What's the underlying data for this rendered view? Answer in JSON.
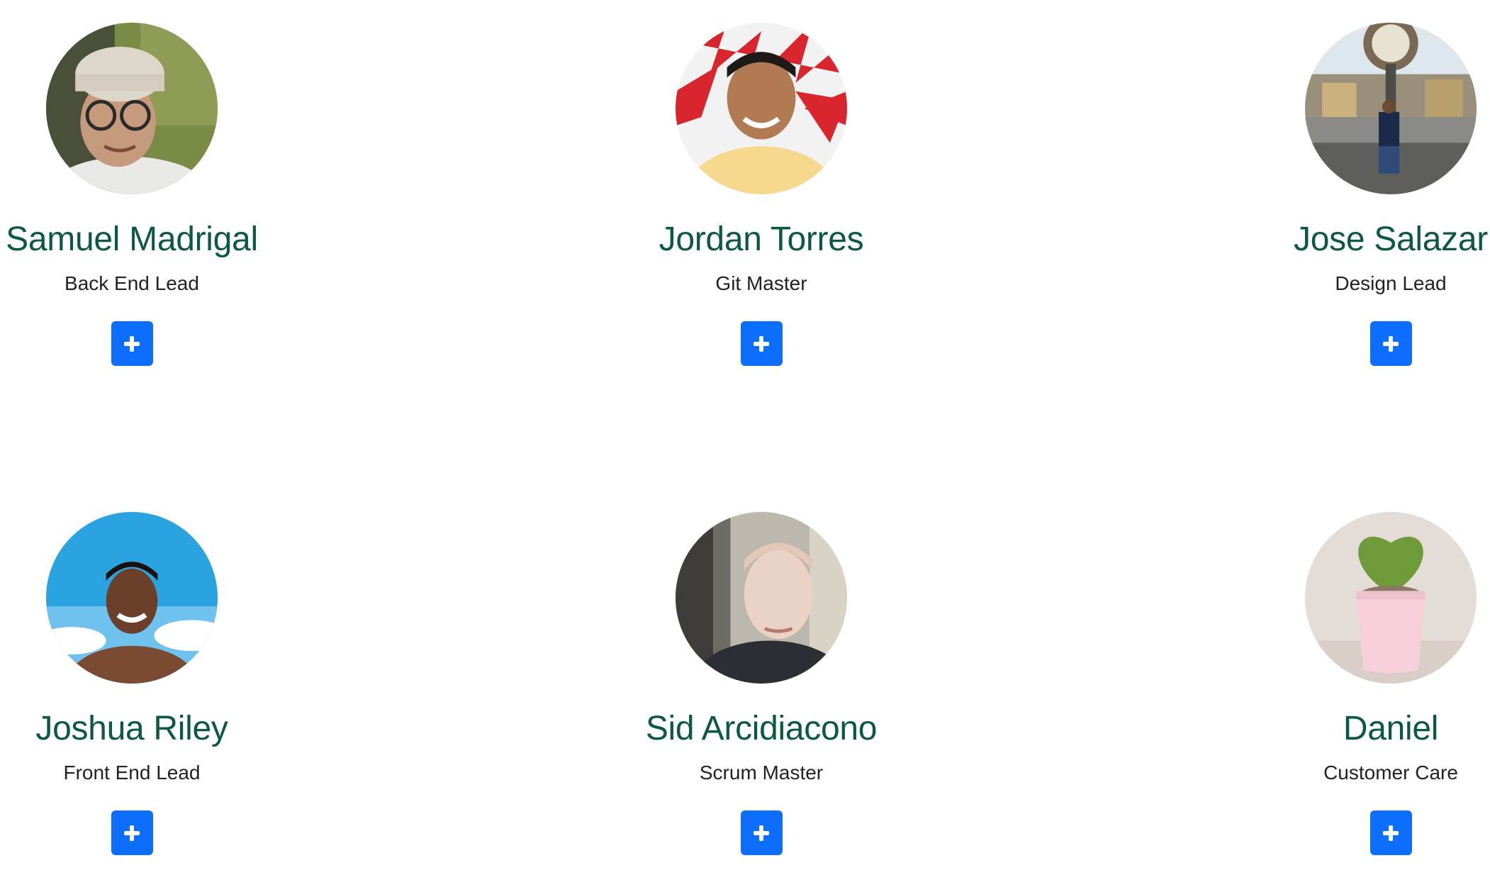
{
  "members": [
    {
      "name": "Samuel Madrigal",
      "role": "Back End Lead"
    },
    {
      "name": "Jordan Torres",
      "role": "Git Master"
    },
    {
      "name": "Jose Salazar",
      "role": "Design Lead"
    },
    {
      "name": "Joshua Riley",
      "role": "Front End Lead"
    },
    {
      "name": "Sid Arcidiacono",
      "role": "Scrum Master"
    },
    {
      "name": "Daniel",
      "role": "Customer Care"
    }
  ],
  "colors": {
    "name_text": "#0b5a3e",
    "role_text": "#222222",
    "button": "#0d6efd"
  },
  "icons": {
    "add_button": "plus-icon"
  }
}
